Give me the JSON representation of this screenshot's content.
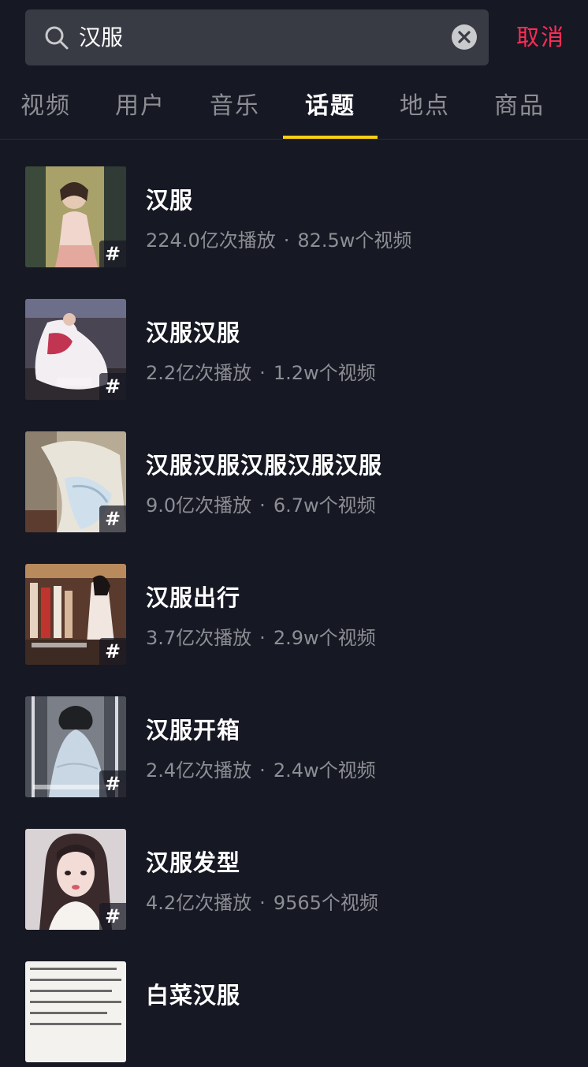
{
  "search": {
    "value": "汉服",
    "cancel_label": "取消"
  },
  "tabs": [
    {
      "label": "视频",
      "active": false
    },
    {
      "label": "用户",
      "active": false
    },
    {
      "label": "音乐",
      "active": false
    },
    {
      "label": "话题",
      "active": true
    },
    {
      "label": "地点",
      "active": false
    },
    {
      "label": "商品",
      "active": false
    }
  ],
  "badge_symbol": "#",
  "stat_separator": "·",
  "topics": [
    {
      "title": "汉服",
      "plays": "224.0亿次播放",
      "videos": "82.5w个视频"
    },
    {
      "title": "汉服汉服",
      "plays": "2.2亿次播放",
      "videos": "1.2w个视频"
    },
    {
      "title": "汉服汉服汉服汉服汉服",
      "plays": "9.0亿次播放",
      "videos": "6.7w个视频"
    },
    {
      "title": "汉服出行",
      "plays": "3.7亿次播放",
      "videos": "2.9w个视频"
    },
    {
      "title": "汉服开箱",
      "plays": "2.4亿次播放",
      "videos": "2.4w个视频"
    },
    {
      "title": "汉服发型",
      "plays": "4.2亿次播放",
      "videos": "9565个视频"
    },
    {
      "title": "白菜汉服",
      "plays": "",
      "videos": ""
    }
  ],
  "colors": {
    "background": "#161823",
    "search_bg": "#393b44",
    "accent_red": "#fe2c55",
    "tab_indicator": "#face15",
    "muted_text": "#8d8e94"
  },
  "icons": {
    "search": "search-icon",
    "clear": "clear-icon",
    "hashtag": "hashtag-icon"
  }
}
